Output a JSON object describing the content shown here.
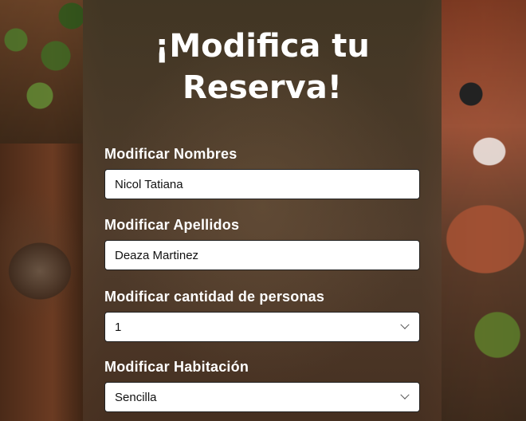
{
  "form": {
    "title": "¡Modifica tu Reserva!",
    "fields": [
      {
        "label": "Modificar Nombres",
        "value": "Nicol Tatiana",
        "type": "text"
      },
      {
        "label": "Modificar Apellidos",
        "value": "Deaza Martinez",
        "type": "text"
      },
      {
        "label": "Modificar cantidad de personas",
        "value": "1",
        "type": "select"
      },
      {
        "label": "Modificar Habitación",
        "value": "Sencilla",
        "type": "select"
      }
    ]
  },
  "icons": {
    "dropdown": "chevron-down-icon"
  },
  "colors": {
    "panel": "#5a4a36",
    "text": "#ffffff",
    "input_bg": "#ffffff"
  }
}
